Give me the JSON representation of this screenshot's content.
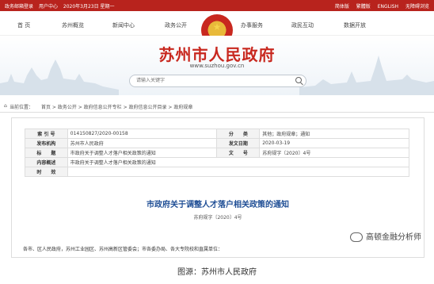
{
  "topbar": {
    "left": [
      "政务邮箱登录",
      "用户中心",
      "2020年3月23日 星期一"
    ],
    "right": [
      "简体版",
      "繁體版",
      "ENGLISH",
      "无障碍浏览"
    ]
  },
  "nav": {
    "items": [
      "首 页",
      "苏州概览",
      "新闻中心",
      "政务公开",
      "办事服务",
      "政民互动",
      "数据开放"
    ]
  },
  "banner": {
    "title": "苏州市人民政府",
    "url": "www.suzhou.gov.cn",
    "search_placeholder": "请输入关键字"
  },
  "breadcrumb": {
    "label": "当前位置：",
    "path": "首页 > 政务公开 > 政府信息公开专栏 > 政府信息公开目录 > 政府规章"
  },
  "meta": {
    "rows": [
      {
        "k1": "索 引 号",
        "v1": "014150827/2020-00158",
        "k2": "分　　类",
        "v2": "其他；政府规章；通知"
      },
      {
        "k1": "发布机构",
        "v1": "苏州市人民政府",
        "k2": "发文日期",
        "v2": "2020-03-19"
      },
      {
        "k1": "标　　题",
        "v1": "市政府关于调整人才落户相关政策的通知",
        "k2": "文　　号",
        "v2": "苏府规字〔2020〕4号"
      },
      {
        "k1": "内容概述",
        "v1": "市政府关于调整人才落户相关政策的通知",
        "k2": "",
        "v2": ""
      },
      {
        "k1": "时　　效",
        "v1": "",
        "k2": "",
        "v2": ""
      }
    ]
  },
  "document": {
    "title": "市政府关于调整人才落户相关政策的通知",
    "number": "苏府规字〔2020〕4号",
    "body": "各市、区人民政府，苏州工业园区、苏州高新区管委会；市各委办局、各大专院校和直属单位："
  },
  "watermark": "高顿金融分析师",
  "caption": "图源：苏州市人民政府",
  "colors": {
    "brand_red": "#b8231d",
    "title_blue": "#1f4e95"
  }
}
